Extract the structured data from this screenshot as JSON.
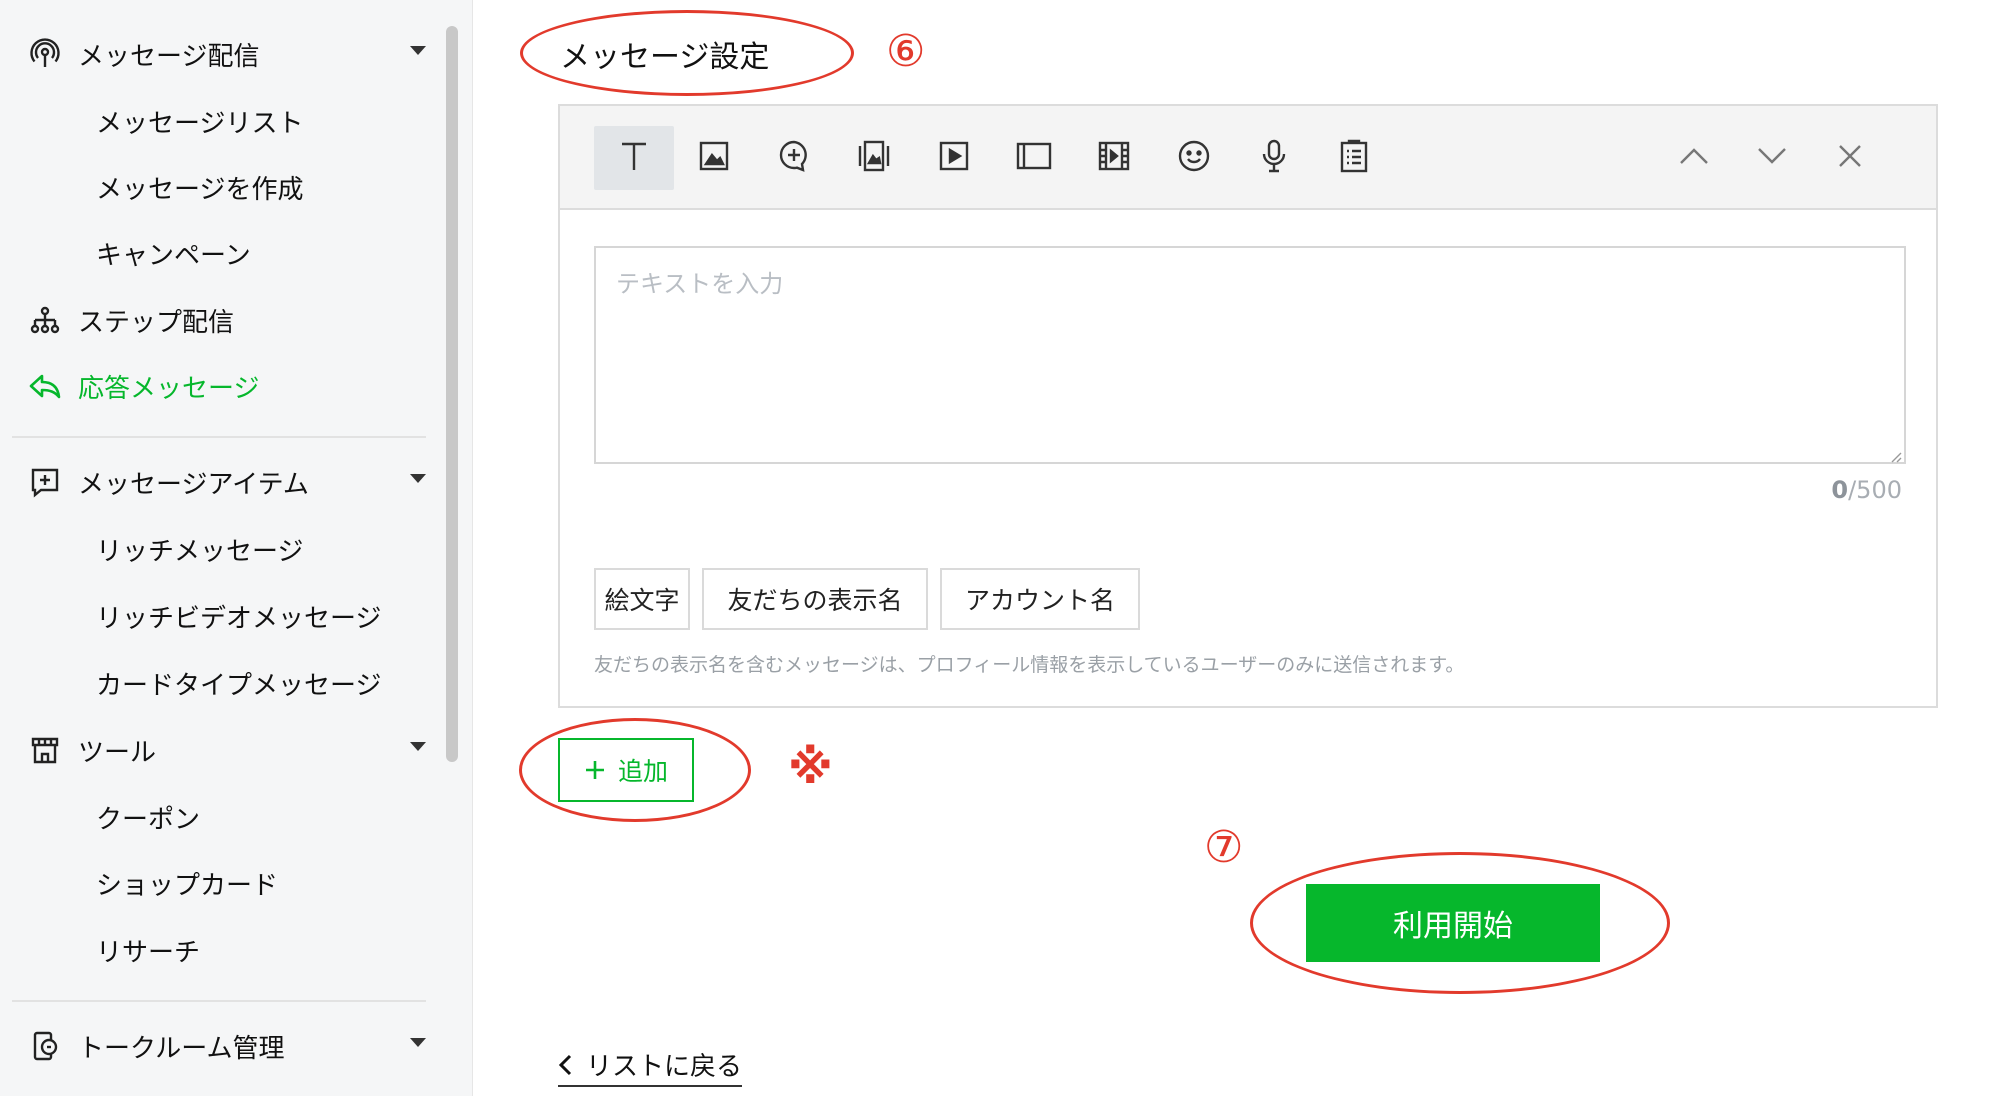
{
  "sidebar": {
    "items": [
      {
        "label": "メッセージ配信",
        "icon": "broadcast-icon"
      },
      {
        "label": "メッセージリスト"
      },
      {
        "label": "メッセージを作成"
      },
      {
        "label": "キャンペーン"
      },
      {
        "label": "ステップ配信",
        "icon": "flow-tree-icon"
      },
      {
        "label": "応答メッセージ",
        "icon": "reply-arrow-icon",
        "active": true
      },
      {
        "label": "メッセージアイテム",
        "icon": "add-box-icon"
      },
      {
        "label": "リッチメッセージ"
      },
      {
        "label": "リッチビデオメッセージ"
      },
      {
        "label": "カードタイプメッセージ"
      },
      {
        "label": "ツール",
        "icon": "shop-icon"
      },
      {
        "label": "クーポン"
      },
      {
        "label": "ショップカード"
      },
      {
        "label": "リサーチ"
      },
      {
        "label": "トークルーム管理",
        "icon": "phone-chat-icon"
      }
    ]
  },
  "main": {
    "section_title": "メッセージ設定",
    "annotation_six": "⑥",
    "annotation_seven": "⑦",
    "asterisk": "※",
    "toolbar": {
      "tools": [
        "text-icon",
        "image-icon",
        "chat-plus-icon",
        "card-icon",
        "video-icon",
        "rich-panel-icon",
        "film-icon",
        "emoji-icon",
        "mic-icon",
        "clipboard-icon"
      ],
      "controls": [
        "chevron-up-icon",
        "chevron-down-icon",
        "close-icon"
      ]
    },
    "textarea_placeholder": "テキストを入力",
    "counter_current": "0",
    "counter_max": "/500",
    "var_buttons": [
      "絵文字",
      "友だちの表示名",
      "アカウント名"
    ],
    "note": "友だちの表示名を含むメッセージは、プロフィール情報を表示しているユーザーのみに送信されます。",
    "add_label": "追加",
    "start_label": "利用開始",
    "back_label": "リストに戻る"
  },
  "colors": {
    "accent": "#06b72c",
    "annotation": "#e23a2c"
  }
}
